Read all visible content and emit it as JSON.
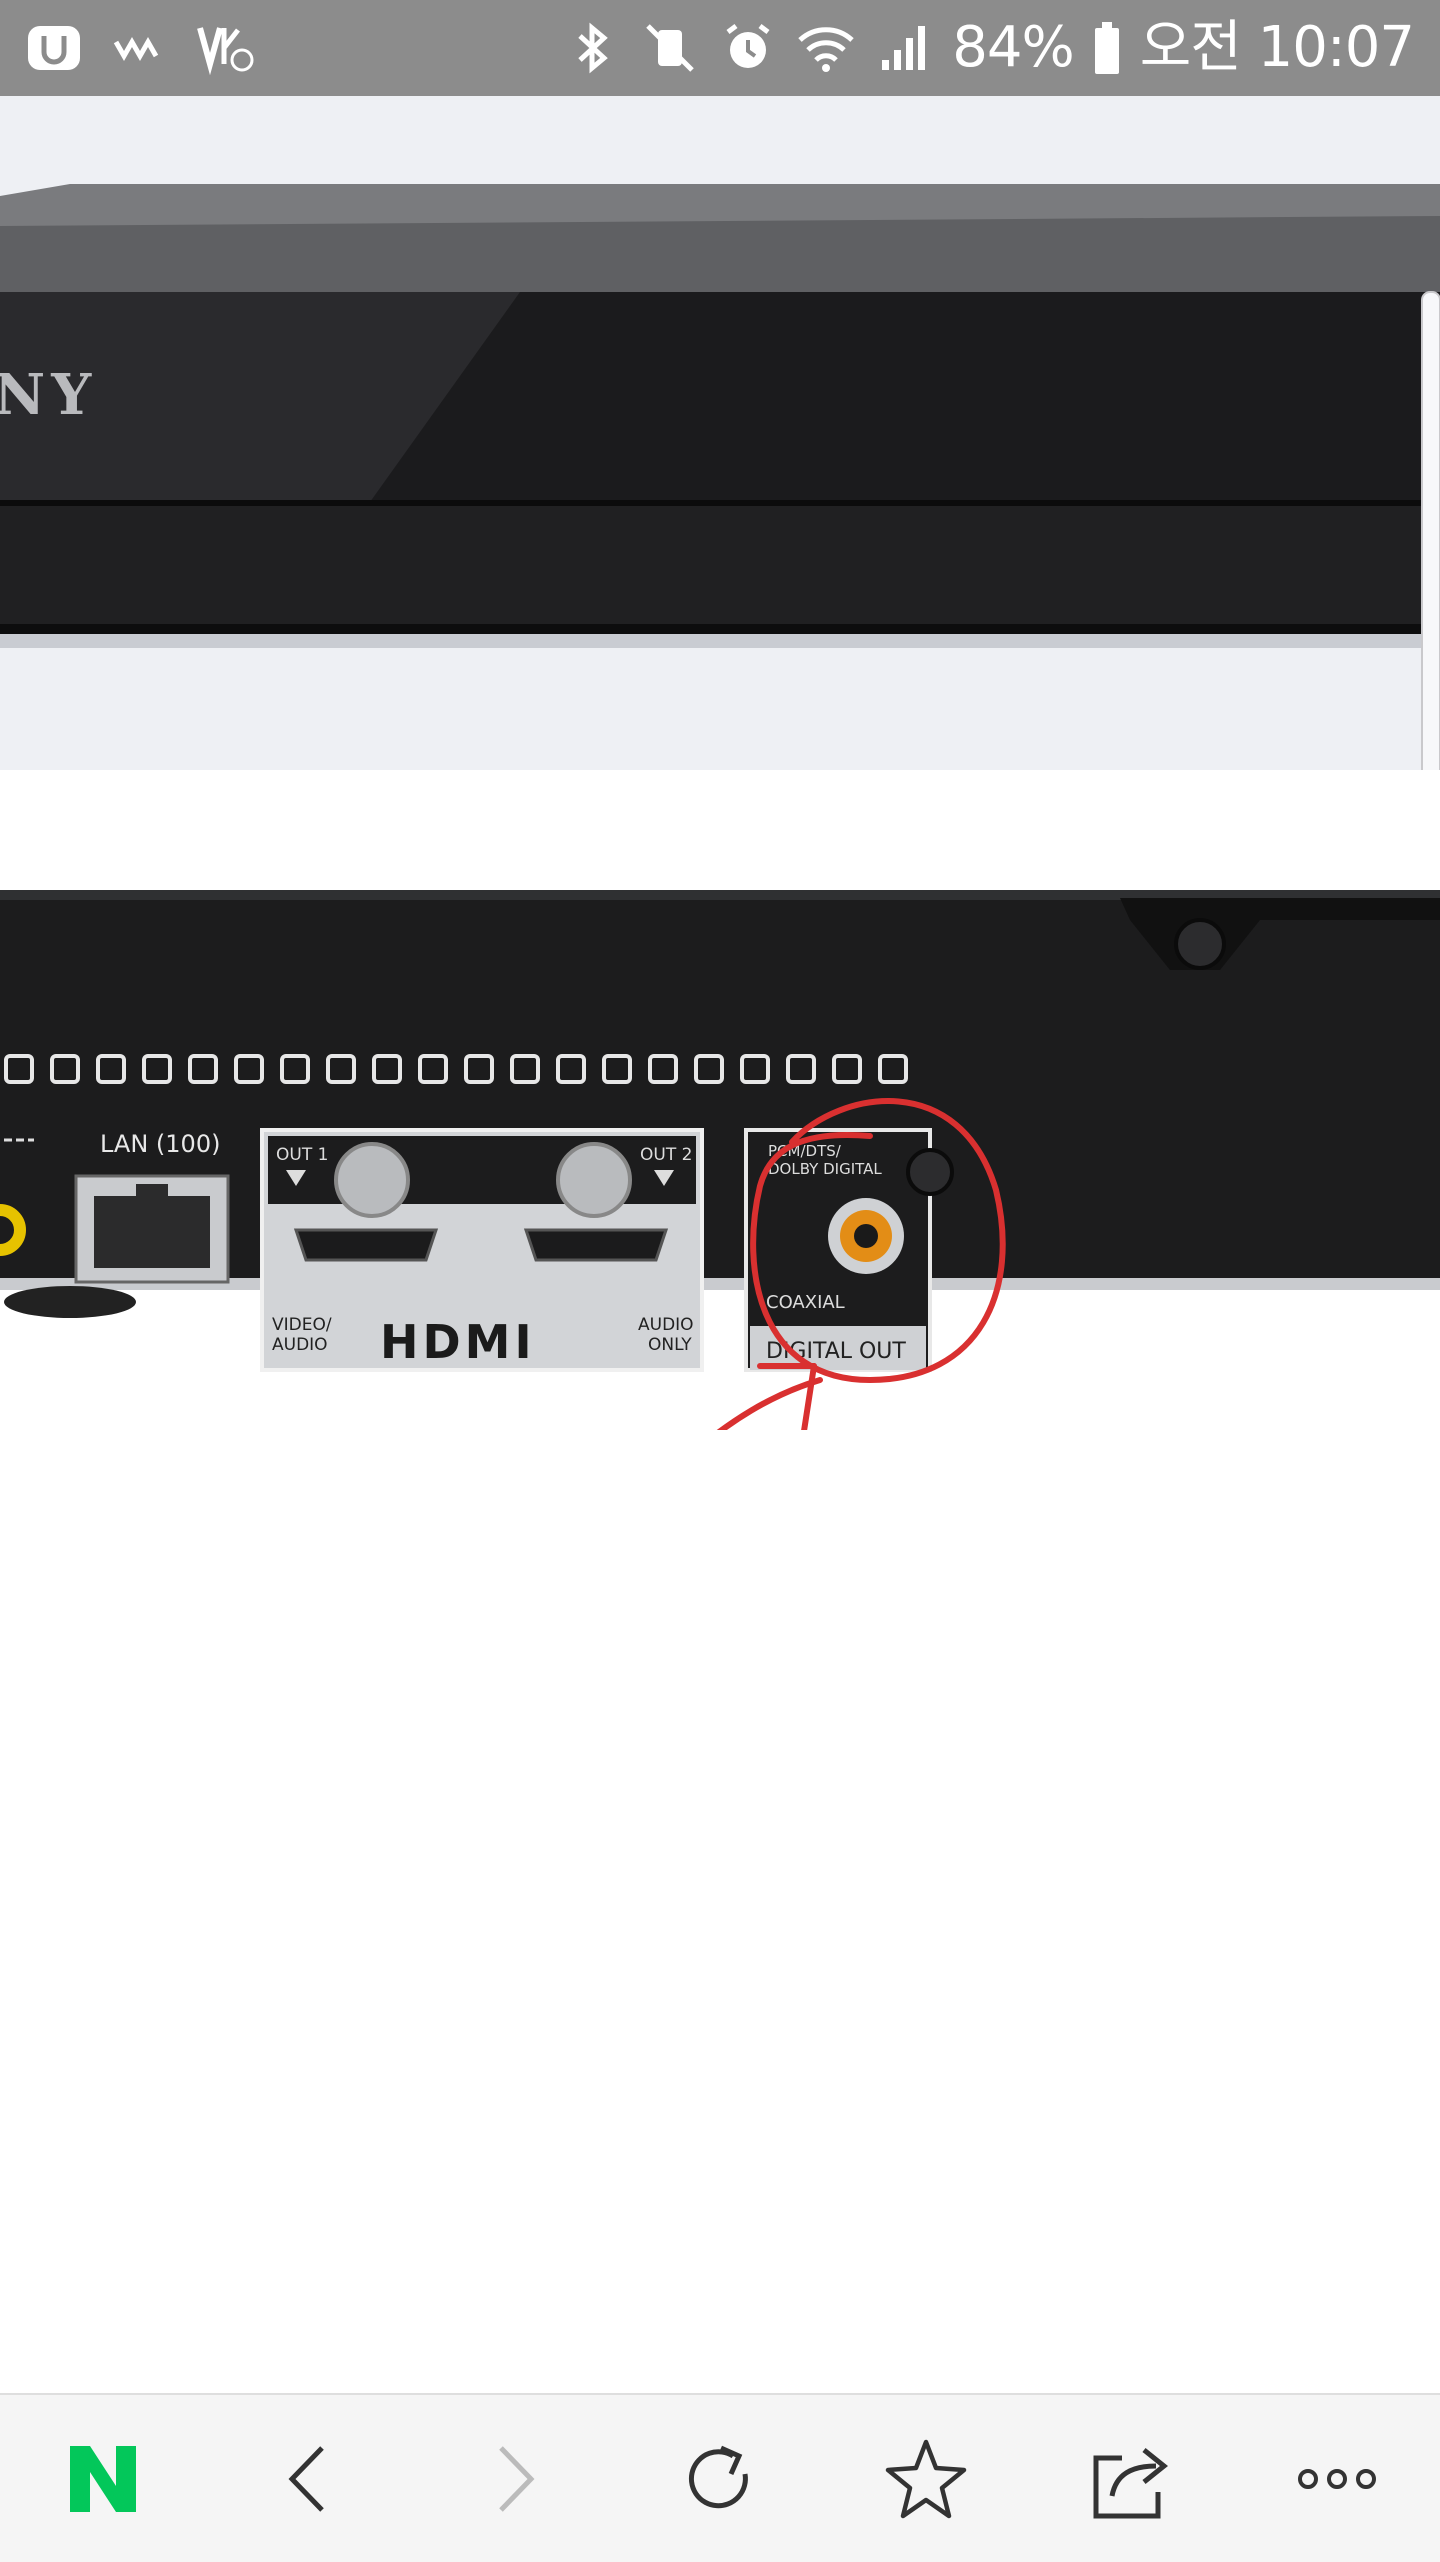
{
  "status_bar": {
    "battery_percent": "84%",
    "time": "오전 10:07",
    "icons": [
      "u-plus-icon",
      "wave-icon",
      "volte-icon",
      "bluetooth-icon",
      "mute-icon",
      "alarm-icon",
      "wifi-icon",
      "signal-icon",
      "battery-icon"
    ]
  },
  "product_image": {
    "brand_partial": "NY",
    "rear_panel": {
      "lan_label": "LAN (100)",
      "hdmi_out1": "OUT 1",
      "hdmi_out2": "OUT 2",
      "hdmi_logo": "HDMI",
      "hdmi_left_caption": "VIDEO/\nAUDIO",
      "hdmi_right_caption": "AUDIO\nONLY",
      "digital_top": "PCM/DTS/\nDOLBY DIGITAL",
      "coaxial": "COAXIAL",
      "digital_out": "DIGITAL OUT"
    }
  },
  "toolbar": {
    "items": [
      "naver-home-icon",
      "back-icon",
      "forward-icon",
      "refresh-icon",
      "bookmark-star-icon",
      "share-icon",
      "more-icon"
    ],
    "accent_color": "#03c75a"
  }
}
